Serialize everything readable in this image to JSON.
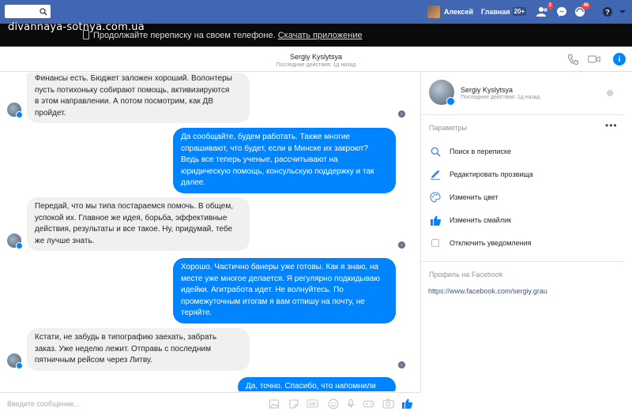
{
  "topbar": {
    "user_name": "Алексей",
    "home_label": "Главная",
    "home_count": "20+",
    "friend_requests_badge": "2",
    "notifications_badge": "46"
  },
  "watermark": "divannaya-sotnya.com.ua",
  "banner": {
    "text": "Продолжайте переписку на своем телефоне.",
    "link": "Скачать приложение"
  },
  "conversation": {
    "name": "Sergiy Kyslytsya",
    "status": "Последние действия: 1д назад"
  },
  "messages": [
    {
      "dir": "in",
      "lines": [
        "Финансы есть. Бюджет заложен хороший. Волонтеры",
        "пусть потихоньку собирают помощь, активизируются",
        "в этом направлении. А потом посмотрим, как ДВ",
        "пройдет."
      ]
    },
    {
      "dir": "out",
      "lines": [
        "Да сообщайте, будем работать. Также многие",
        "спрашивают, что будет, если в Минске их закроют?",
        "Ведь все теперь ученые, рассчитывают на",
        "юридическую помощь, консульскую поддержку и так",
        "далее."
      ]
    },
    {
      "dir": "in",
      "lines": [
        "Передай, что мы типа постараемся помочь. В общем,",
        "успокой их. Главное же идея, борьба, эффективные",
        "действия, результаты и все такое. Ну, придумай, тебе",
        "же лучше знать."
      ]
    },
    {
      "dir": "out",
      "lines": [
        "Хорошо. Частично банеры уже готовы. Как я знаю, на",
        "месте уже многое делается. Я регулярно подкидываю",
        "идейки. Агитработа идет. Не волнуйтесь. По",
        "промежуточным итогам я вам отпишу на почту, не",
        "теряйте."
      ]
    },
    {
      "dir": "in",
      "lines": [
        "Кстати, не забудь в типографию заехать, забрать",
        "заказ. Уже неделю лежит.  Отправь с последним",
        "пятничным рейсом через Литву."
      ]
    },
    {
      "dir": "out",
      "lines": [
        "Да, точно. Спасибо, что напомнили"
      ]
    }
  ],
  "composer": {
    "placeholder": "Введите сообщение..."
  },
  "side": {
    "name": "Sergiy Kyslytsya",
    "status": "Последние действия: 1д назад",
    "params_title": "Параметры",
    "options": [
      {
        "label": "Поиск в переписке",
        "icon": "search-icon"
      },
      {
        "label": "Редактировать прозвища",
        "icon": "pencil-icon"
      },
      {
        "label": "Изменить цвет",
        "icon": "palette-icon"
      },
      {
        "label": "Изменить смайлик",
        "icon": "thumbs-up-icon"
      },
      {
        "label": "Отключить уведомления",
        "icon": "checkbox-icon"
      }
    ],
    "profile_title": "Профиль на Facebook",
    "profile_link": "https://www.facebook.com/sergiy.grau"
  },
  "colors": {
    "facebook_blue": "#4267b2",
    "messenger_blue": "#0084ff",
    "incoming_bubble": "#f1f0f0"
  }
}
